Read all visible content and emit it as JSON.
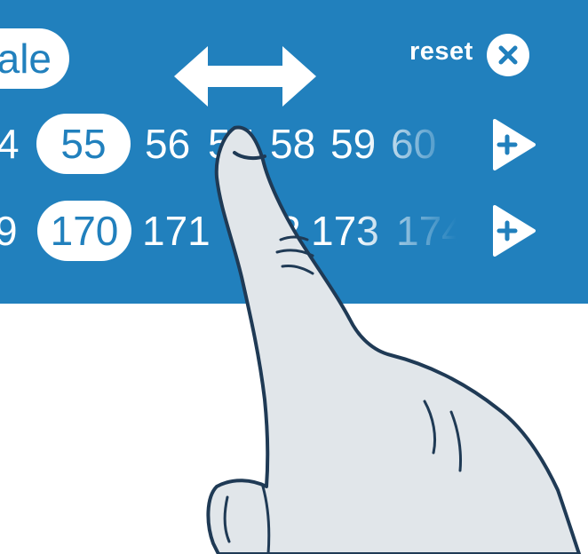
{
  "gender_pill": {
    "label": "ale"
  },
  "reset": {
    "label": "reset"
  },
  "age_row": {
    "values": [
      "4",
      "55",
      "56",
      "57",
      "58",
      "59",
      "60"
    ],
    "selected": "55"
  },
  "height_row": {
    "values": [
      "9",
      "170",
      "171",
      "172",
      "173",
      "174"
    ],
    "selected": "170"
  },
  "colors": {
    "panel": "#2180bd",
    "selected_text": "#2180bd",
    "hand_fill": "#e1e6ea",
    "hand_outline": "#1f3a55"
  },
  "icons": {
    "swipe": "left-right-arrow-icon",
    "reset": "close-icon",
    "add": "play-plus-icon"
  }
}
